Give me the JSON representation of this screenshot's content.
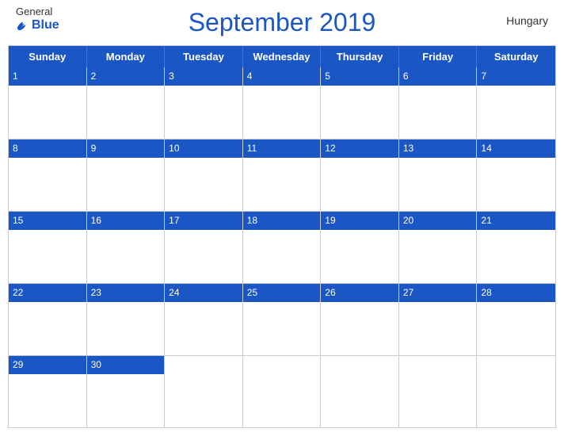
{
  "header": {
    "title": "September 2019",
    "country": "Hungary",
    "logo_general": "General",
    "logo_blue": "Blue"
  },
  "days_of_week": [
    "Sunday",
    "Monday",
    "Tuesday",
    "Wednesday",
    "Thursday",
    "Friday",
    "Saturday"
  ],
  "weeks": [
    [
      1,
      2,
      3,
      4,
      5,
      6,
      7
    ],
    [
      8,
      9,
      10,
      11,
      12,
      13,
      14
    ],
    [
      15,
      16,
      17,
      18,
      19,
      20,
      21
    ],
    [
      22,
      23,
      24,
      25,
      26,
      27,
      28
    ],
    [
      29,
      30,
      null,
      null,
      null,
      null,
      null
    ]
  ]
}
